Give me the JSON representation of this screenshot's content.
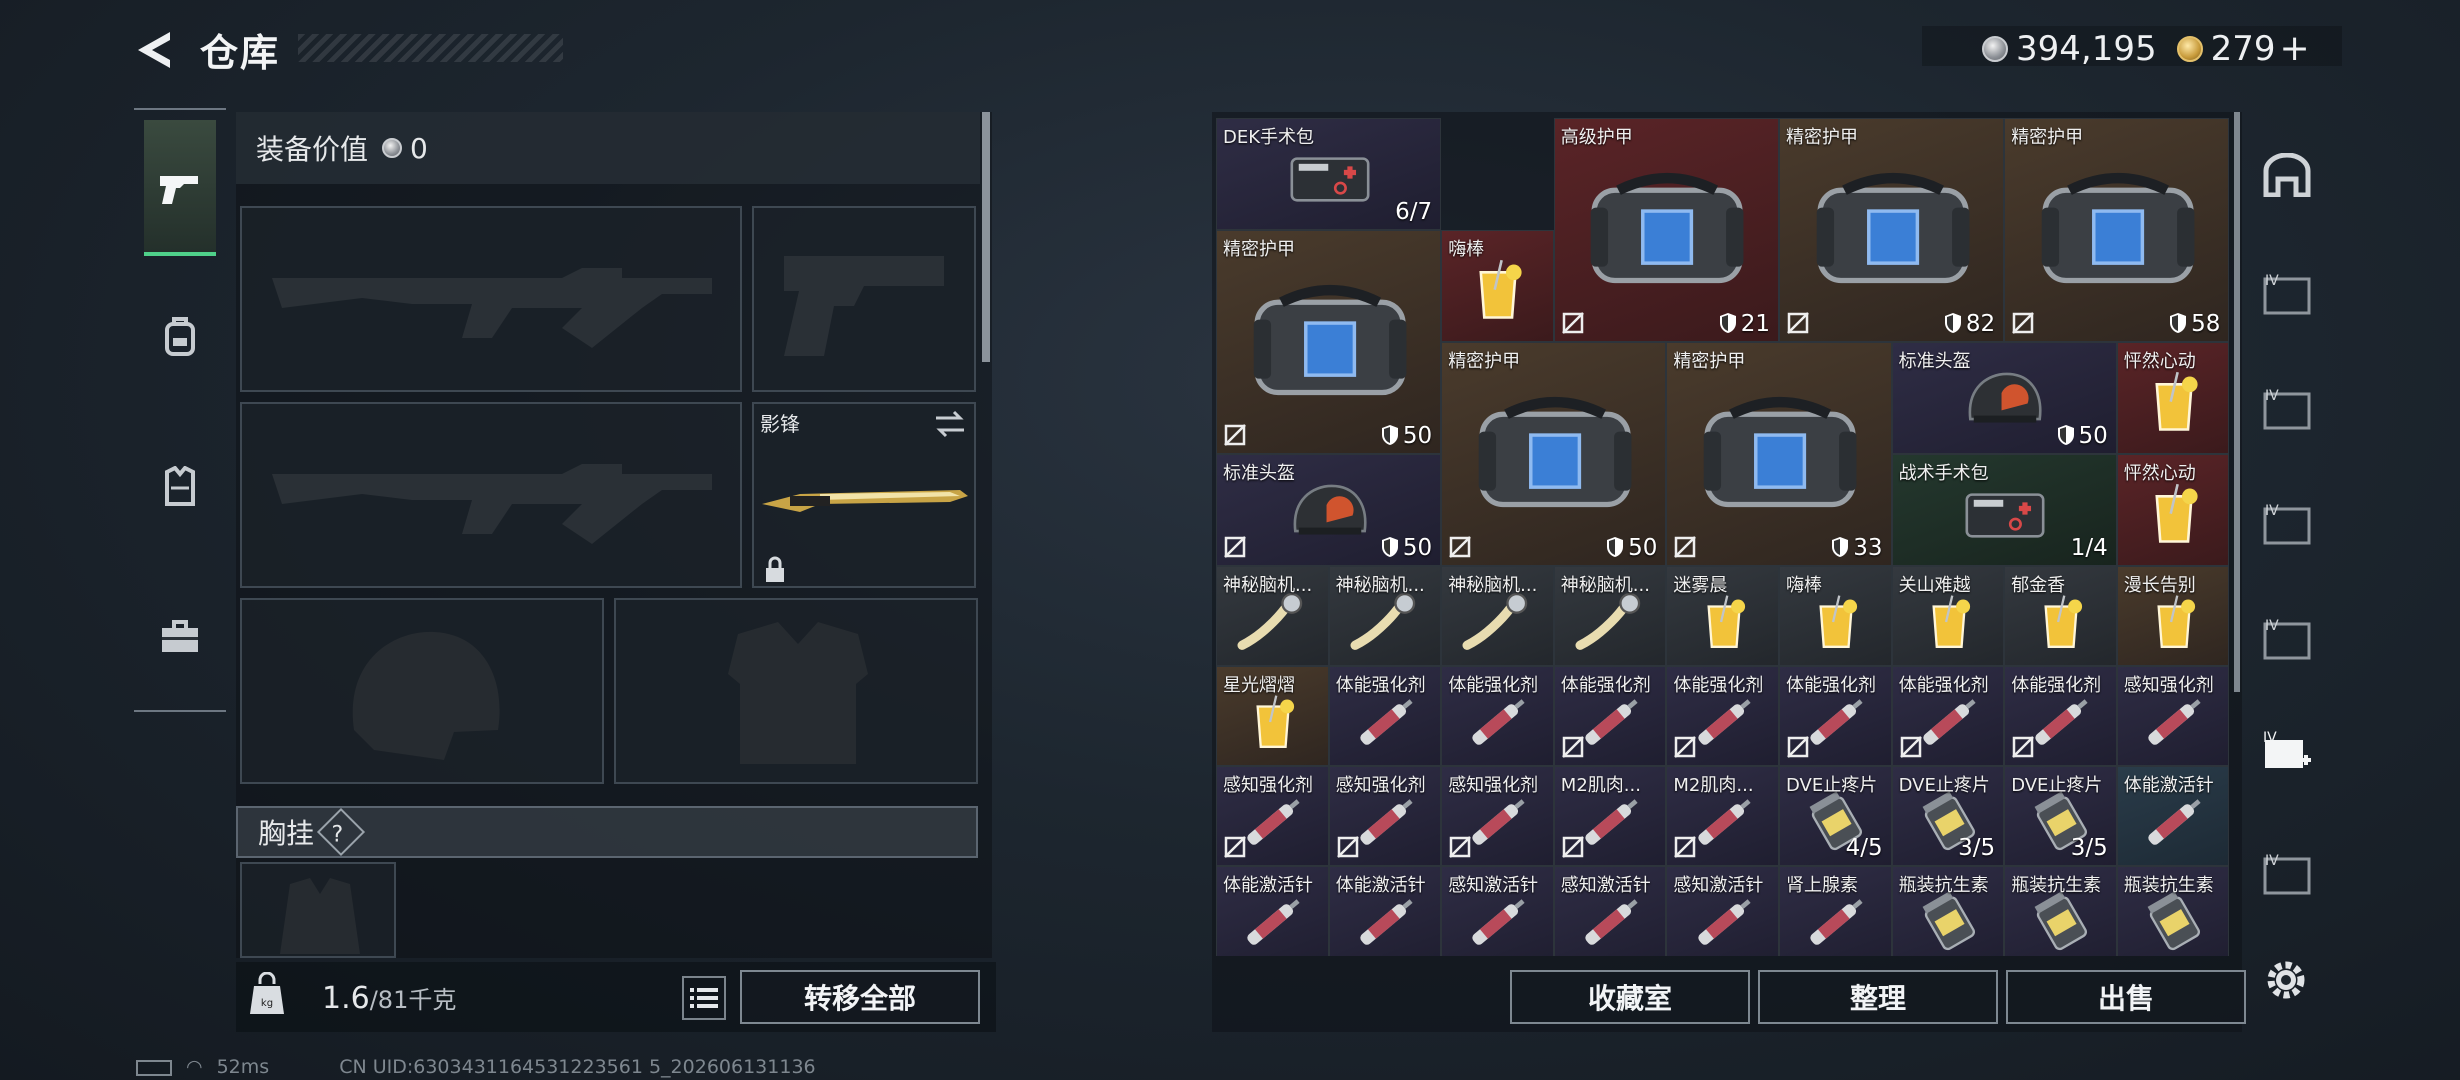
{
  "header": {
    "title": "仓库"
  },
  "currency": {
    "silver": "394,195",
    "gold": "279",
    "plus": "+"
  },
  "equipment": {
    "value_label": "装备价值",
    "value": "0",
    "melee_name": "影锋",
    "chest_label": "胸挂",
    "chest_help": "?"
  },
  "footer": {
    "weight": "1.6",
    "weight_max": "/81千克",
    "transfer_all": "转移全部",
    "collection": "收藏室",
    "sort": "整理",
    "sell": "出售"
  },
  "status": {
    "ping": "52ms",
    "uid": "CN UID:6303431164531223561 5_202606131136"
  },
  "inventory": [
    {
      "name": "DEK手术包",
      "value": "6/7",
      "rarity": "purple",
      "icon": "first-aid-kit",
      "noSell": false
    },
    {
      "name": "高级护甲",
      "value": "21",
      "rarity": "red",
      "icon": "armor-bag",
      "noSell": true,
      "shield": true
    },
    {
      "name": "精密护甲",
      "value": "82",
      "rarity": "brown",
      "icon": "armor-bag",
      "noSell": true,
      "shield": true
    },
    {
      "name": "精密护甲",
      "value": "58",
      "rarity": "brown",
      "icon": "armor-bag",
      "noSell": true,
      "shield": true
    },
    {
      "name": "精密护甲",
      "value": "50",
      "rarity": "brown",
      "icon": "armor-bag",
      "noSell": true,
      "shield": true
    },
    {
      "name": "嗨棒",
      "value": "",
      "rarity": "red",
      "icon": "drink",
      "noSell": false
    },
    {
      "name": "精密护甲",
      "value": "50",
      "rarity": "brown",
      "icon": "armor-bag",
      "noSell": true,
      "shield": true
    },
    {
      "name": "精密护甲",
      "value": "33",
      "rarity": "brown",
      "icon": "armor-bag",
      "noSell": true,
      "shield": true
    },
    {
      "name": "标准头盔",
      "value": "50",
      "rarity": "purple",
      "icon": "helmet",
      "noSell": false,
      "shield": true
    },
    {
      "name": "怦然心动",
      "value": "",
      "rarity": "red",
      "icon": "drink",
      "noSell": false
    },
    {
      "name": "标准头盔",
      "value": "50",
      "rarity": "purple",
      "icon": "helmet",
      "noSell": true,
      "shield": true
    },
    {
      "name": "战术手术包",
      "value": "1/4",
      "rarity": "green",
      "icon": "first-aid-kit",
      "noSell": false
    },
    {
      "name": "怦然心动",
      "value": "",
      "rarity": "red",
      "icon": "drink",
      "noSell": false
    },
    {
      "name": "神秘脑机...",
      "value": "",
      "rarity": "gray",
      "icon": "neuro-device",
      "noSell": false
    },
    {
      "name": "神秘脑机...",
      "value": "",
      "rarity": "gray",
      "icon": "neuro-device",
      "noSell": false
    },
    {
      "name": "神秘脑机...",
      "value": "",
      "rarity": "gray",
      "icon": "neuro-device",
      "noSell": false
    },
    {
      "name": "神秘脑机...",
      "value": "",
      "rarity": "gray",
      "icon": "neuro-device",
      "noSell": false
    },
    {
      "name": "迷雾晨",
      "value": "",
      "rarity": "gray",
      "icon": "drink",
      "noSell": false
    },
    {
      "name": "嗨棒",
      "value": "",
      "rarity": "gray",
      "icon": "drink",
      "noSell": false
    },
    {
      "name": "关山难越",
      "value": "",
      "rarity": "gray",
      "icon": "drink",
      "noSell": false
    },
    {
      "name": "郁金香",
      "value": "",
      "rarity": "gray",
      "icon": "drink",
      "noSell": false
    },
    {
      "name": "漫长告别",
      "value": "",
      "rarity": "brown",
      "icon": "drink",
      "noSell": false
    },
    {
      "name": "星光熠熠",
      "value": "",
      "rarity": "brown",
      "icon": "drink",
      "noSell": false
    },
    {
      "name": "体能强化剂",
      "value": "",
      "rarity": "purple",
      "icon": "injector",
      "noSell": false
    },
    {
      "name": "体能强化剂",
      "value": "",
      "rarity": "purple",
      "icon": "injector",
      "noSell": false
    },
    {
      "name": "体能强化剂",
      "value": "",
      "rarity": "purple",
      "icon": "injector",
      "noSell": true
    },
    {
      "name": "体能强化剂",
      "value": "",
      "rarity": "purple",
      "icon": "injector",
      "noSell": true
    },
    {
      "name": "体能强化剂",
      "value": "",
      "rarity": "purple",
      "icon": "injector",
      "noSell": true
    },
    {
      "name": "体能强化剂",
      "value": "",
      "rarity": "purple",
      "icon": "injector",
      "noSell": true
    },
    {
      "name": "体能强化剂",
      "value": "",
      "rarity": "purple",
      "icon": "injector",
      "noSell": true
    },
    {
      "name": "感知强化剂",
      "value": "",
      "rarity": "purple",
      "icon": "injector",
      "noSell": false
    },
    {
      "name": "感知强化剂",
      "value": "",
      "rarity": "purple",
      "icon": "injector",
      "noSell": true
    },
    {
      "name": "感知强化剂",
      "value": "",
      "rarity": "purple",
      "icon": "injector",
      "noSell": true
    },
    {
      "name": "感知强化剂",
      "value": "",
      "rarity": "purple",
      "icon": "injector",
      "noSell": true
    },
    {
      "name": "M2肌肉...",
      "value": "",
      "rarity": "purple",
      "icon": "injector",
      "noSell": true
    },
    {
      "name": "M2肌肉...",
      "value": "",
      "rarity": "purple",
      "icon": "injector",
      "noSell": true
    },
    {
      "name": "DVE止疼片",
      "value": "4/5",
      "rarity": "purple",
      "icon": "pill-bottle",
      "noSell": false
    },
    {
      "name": "DVE止疼片",
      "value": "3/5",
      "rarity": "purple",
      "icon": "pill-bottle",
      "noSell": false
    },
    {
      "name": "DVE止疼片",
      "value": "3/5",
      "rarity": "purple",
      "icon": "pill-bottle",
      "noSell": false
    },
    {
      "name": "体能激活针",
      "value": "",
      "rarity": "blue",
      "icon": "injector",
      "noSell": false
    },
    {
      "name": "体能激活针",
      "value": "",
      "rarity": "purple",
      "icon": "injector",
      "noSell": false
    },
    {
      "name": "体能激活针",
      "value": "",
      "rarity": "purple",
      "icon": "injector",
      "noSell": false
    },
    {
      "name": "感知激活针",
      "value": "",
      "rarity": "purple",
      "icon": "injector",
      "noSell": false
    },
    {
      "name": "感知激活针",
      "value": "",
      "rarity": "purple",
      "icon": "injector",
      "noSell": false
    },
    {
      "name": "感知激活针",
      "value": "",
      "rarity": "purple",
      "icon": "injector",
      "noSell": false
    },
    {
      "name": "肾上腺素",
      "value": "",
      "rarity": "purple",
      "icon": "injector",
      "noSell": false
    },
    {
      "name": "瓶装抗生素",
      "value": "",
      "rarity": "purple",
      "icon": "pill-bottle",
      "noSell": false
    },
    {
      "name": "瓶装抗生素",
      "value": "",
      "rarity": "purple",
      "icon": "pill-bottle",
      "noSell": false
    },
    {
      "name": "瓶装抗生素",
      "value": "",
      "rarity": "purple",
      "icon": "pill-bottle",
      "noSell": false
    }
  ]
}
